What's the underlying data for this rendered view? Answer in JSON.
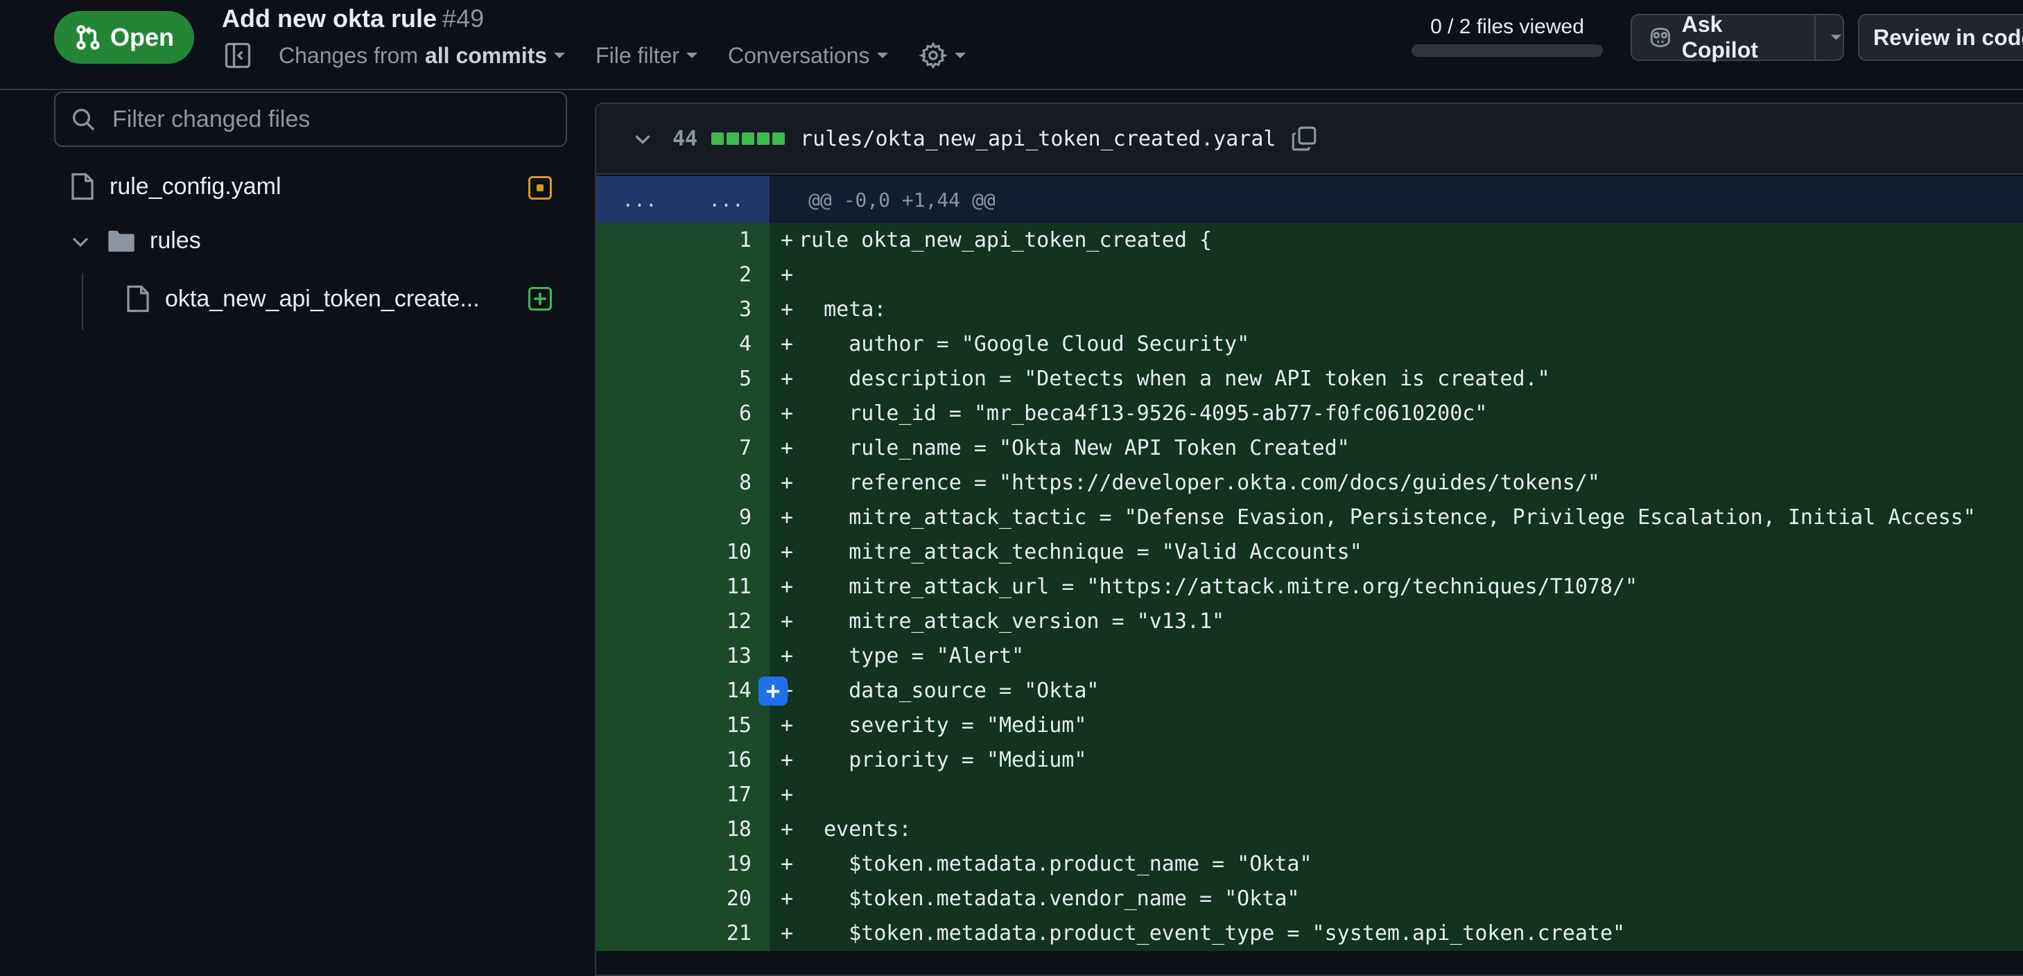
{
  "header": {
    "status_label": "Open",
    "pr_title": "Add new okta rule",
    "pr_number": "#49",
    "changes_from_label": "Changes from",
    "changes_from_value": "all commits",
    "file_filter_label": "File filter",
    "conversations_label": "Conversations",
    "files_viewed_text": "0 / 2 files viewed",
    "files_viewed_progress": 0,
    "ask_copilot_label": "Ask Copilot",
    "review_label": "Review in code"
  },
  "sidebar": {
    "filter_placeholder": "Filter changed files",
    "files": [
      {
        "name": "rule_config.yaml",
        "status": "modified"
      },
      {
        "name": "rules",
        "type": "folder",
        "expanded": true
      },
      {
        "name": "okta_new_api_token_create...",
        "status": "added"
      }
    ]
  },
  "diff": {
    "lines_changed": "44",
    "file_path": "rules/okta_new_api_token_created.yaral",
    "expand_left": "...",
    "expand_right": "...",
    "hunk_header": "@@ -0,0 +1,44 @@",
    "lines": [
      {
        "num": "1",
        "code": "rule okta_new_api_token_created {"
      },
      {
        "num": "2",
        "code": ""
      },
      {
        "num": "3",
        "code": "  meta:"
      },
      {
        "num": "4",
        "code": "    author = \"Google Cloud Security\""
      },
      {
        "num": "5",
        "code": "    description = \"Detects when a new API token is created.\""
      },
      {
        "num": "6",
        "code": "    rule_id = \"mr_beca4f13-9526-4095-ab77-f0fc0610200c\""
      },
      {
        "num": "7",
        "code": "    rule_name = \"Okta New API Token Created\""
      },
      {
        "num": "8",
        "code": "    reference = \"https://developer.okta.com/docs/guides/tokens/\""
      },
      {
        "num": "9",
        "code": "    mitre_attack_tactic = \"Defense Evasion, Persistence, Privilege Escalation, Initial Access\""
      },
      {
        "num": "10",
        "code": "    mitre_attack_technique = \"Valid Accounts\""
      },
      {
        "num": "11",
        "code": "    mitre_attack_url = \"https://attack.mitre.org/techniques/T1078/\""
      },
      {
        "num": "12",
        "code": "    mitre_attack_version = \"v13.1\""
      },
      {
        "num": "13",
        "code": "    type = \"Alert\""
      },
      {
        "num": "14",
        "code": "    data_source = \"Okta\""
      },
      {
        "num": "15",
        "code": "    severity = \"Medium\""
      },
      {
        "num": "16",
        "code": "    priority = \"Medium\""
      },
      {
        "num": "17",
        "code": ""
      },
      {
        "num": "18",
        "code": "  events:"
      },
      {
        "num": "19",
        "code": "    $token.metadata.product_name = \"Okta\""
      },
      {
        "num": "20",
        "code": "    $token.metadata.vendor_name = \"Okta\""
      },
      {
        "num": "21",
        "code": "    $token.metadata.product_event_type = \"system.api_token.create\""
      }
    ],
    "add_marker": "+",
    "add_comment_symbol": "+"
  },
  "colors": {
    "accent_green": "#238636",
    "added_line_bg": "#11331f",
    "added_gutter_bg": "#1a4a29",
    "modified_status": "#d29922",
    "added_status": "#3fb950",
    "comment_button": "#1f6feb"
  }
}
